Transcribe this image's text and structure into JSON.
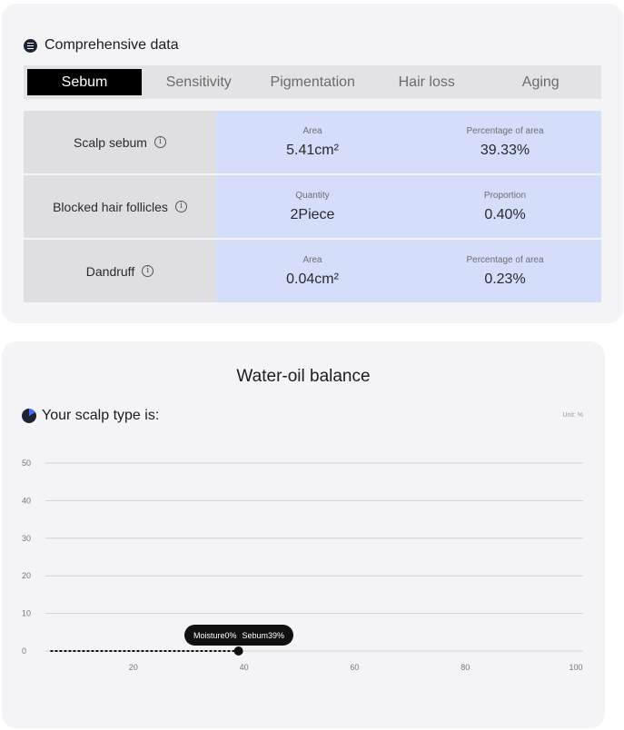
{
  "comprehensive": {
    "title": "Comprehensive data",
    "tabs": [
      "Sebum",
      "Sensitivity",
      "Pigmentation",
      "Hair loss",
      "Aging"
    ],
    "active_tab": "Sebum",
    "rows": [
      {
        "label": "Scalp sebum",
        "c1_label": "Area",
        "c1_value": "5.41cm²",
        "c2_label": "Percentage of area",
        "c2_value": "39.33%"
      },
      {
        "label": "Blocked hair follicles",
        "c1_label": "Quantity",
        "c1_value": "2Piece",
        "c2_label": "Proportion",
        "c2_value": "0.40%"
      },
      {
        "label": "Dandruff",
        "c1_label": "Area",
        "c1_value": "0.04cm²",
        "c2_label": "Percentage of area",
        "c2_value": "0.23%"
      }
    ]
  },
  "balance": {
    "title": "Water-oil balance",
    "scalp_type_label": "Your scalp type is:",
    "unit": "Unit: %",
    "tooltip": {
      "moisture": "Moisture0%",
      "sebum": "Sebum39%"
    }
  },
  "colors": {
    "accent": "#4a6cf7",
    "cell_bg": "#d4defa",
    "label_bg": "#dfdfe2"
  },
  "chart_data": {
    "type": "line",
    "x_ticks": [
      20,
      40,
      60,
      80,
      100
    ],
    "y_ticks": [
      0,
      10,
      20,
      30,
      40,
      50
    ],
    "xlim": [
      5,
      100
    ],
    "ylim": [
      0,
      50
    ],
    "series": [
      {
        "x": [
          5,
          40
        ],
        "y": [
          0,
          0
        ],
        "style": "dotted",
        "marker_at_end": true
      }
    ],
    "grid": true
  }
}
